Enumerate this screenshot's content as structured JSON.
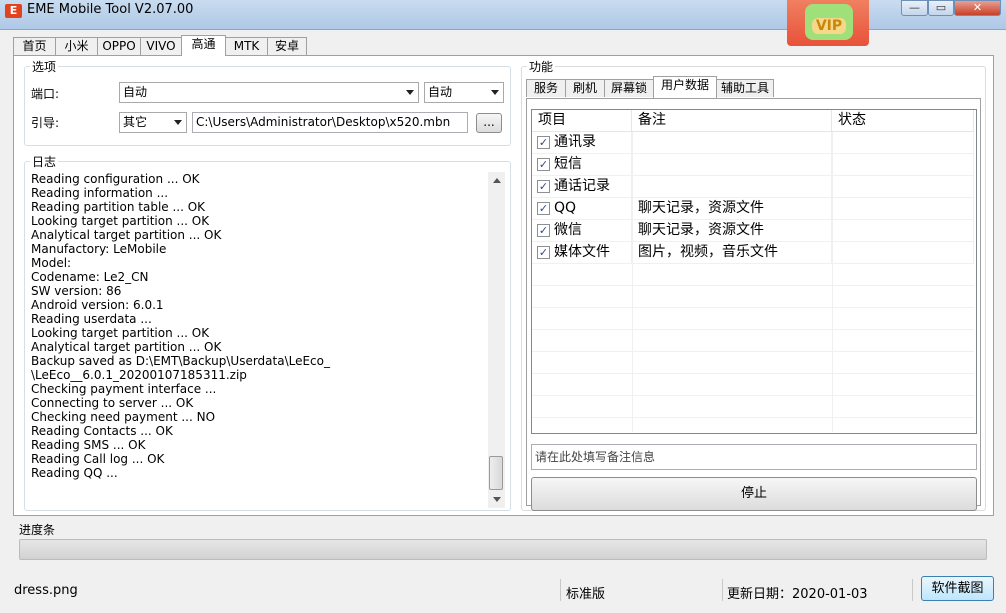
{
  "window": {
    "title": "EME Mobile Tool V2.07.00",
    "app_icon_text": "E",
    "minimize": "—",
    "maximize": "▭",
    "close": "✕",
    "vip_label": "VIP"
  },
  "main_tabs": [
    "首页",
    "小米",
    "OPPO",
    "VIVO",
    "高通",
    "MTK",
    "安卓"
  ],
  "main_tabs_active": 4,
  "options": {
    "legend": "选项",
    "port_label": "端口:",
    "port_value": "自动",
    "port_mode_value": "自动",
    "boot_label": "引导:",
    "boot_value": "其它",
    "boot_path": "C:\\Users\\Administrator\\Desktop\\x520.mbn",
    "browse_label": "..."
  },
  "log": {
    "legend": "日志",
    "lines": [
      "Reading configuration ... OK",
      "Reading information ...",
      "Reading partition table ... OK",
      "Looking target partition ... OK",
      "Analytical target partition ... OK",
      "Manufactory: LeMobile",
      "Model:",
      "Codename: Le2_CN",
      "SW version: 86",
      "Android version: 6.0.1",
      "Reading userdata ...",
      "Looking target partition ... OK",
      "Analytical target partition ... OK",
      "Backup saved as D:\\EMT\\Backup\\Userdata\\LeEco_",
      "\\LeEco__6.0.1_20200107185311.zip",
      "Checking payment interface ...",
      "Connecting to server ... OK",
      "Checking need payment ... NO",
      "Reading Contacts ... OK",
      "Reading SMS ... OK",
      "Reading Call log ... OK",
      "Reading QQ ..."
    ]
  },
  "functions": {
    "legend": "功能",
    "tabs": [
      "服务",
      "刷机",
      "屏幕锁",
      "用户数据",
      "辅助工具"
    ],
    "active_tab": 3,
    "columns": [
      "项目",
      "备注",
      "状态"
    ],
    "rows": [
      {
        "checked": true,
        "item": "通讯录",
        "note": "",
        "status": ""
      },
      {
        "checked": true,
        "item": "短信",
        "note": "",
        "status": ""
      },
      {
        "checked": true,
        "item": "通话记录",
        "note": "",
        "status": ""
      },
      {
        "checked": true,
        "item": "QQ",
        "note": "聊天记录，资源文件",
        "status": ""
      },
      {
        "checked": true,
        "item": "微信",
        "note": "聊天记录，资源文件",
        "status": ""
      },
      {
        "checked": true,
        "item": "媒体文件",
        "note": "图片，视频，音乐文件",
        "status": ""
      }
    ],
    "note_placeholder": "请在此处填写备注信息",
    "stop_label": "停止",
    "check_glyph": "✓"
  },
  "progress": {
    "label": "进度条",
    "percent": 0
  },
  "status": {
    "file": "dress.png",
    "edition": "标准版",
    "update_date": "更新日期：2020-01-03",
    "screenshot_button": "软件截图"
  }
}
